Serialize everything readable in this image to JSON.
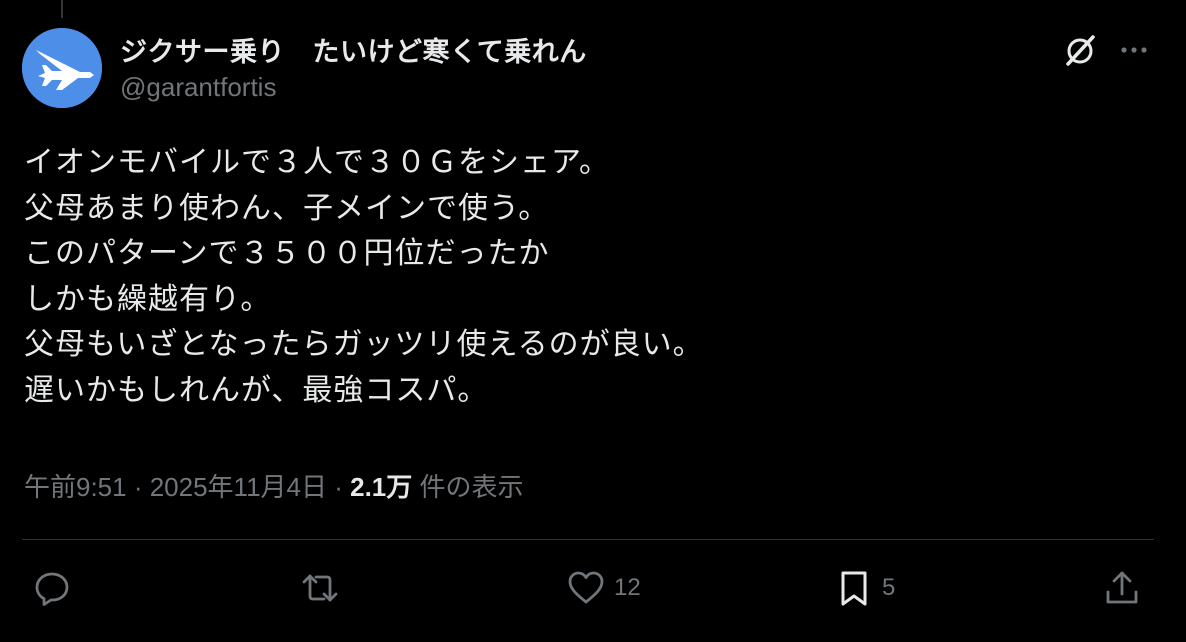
{
  "author": {
    "display_name": "ジクサー乗り　たいけど寒くて乗れん",
    "handle": "@garantfortis",
    "avatar_color": "#4d8fe8"
  },
  "tweet": {
    "lines": [
      "イオンモバイルで３人で３０Ｇをシェア。",
      "父母あまり使わん、子メインで使う。",
      "このパターンで３５００円位だったか",
      "しかも繰越有り。",
      "父母もいざとなったらガッツリ使えるのが良い。",
      "遅いかもしれんが、最強コスパ。"
    ]
  },
  "meta": {
    "time": "午前9:51",
    "separator1": " · ",
    "date": "2025年11月4日",
    "separator2": " · ",
    "views_count": "2.1万",
    "views_label": " 件の表示"
  },
  "actions": {
    "reply_count": "",
    "repost_count": "",
    "like_count": "12",
    "bookmark_count": "5"
  },
  "icons": {
    "grok": "grok-icon",
    "more": "more-icon",
    "reply": "reply-icon",
    "repost": "repost-icon",
    "like": "heart-icon",
    "bookmark": "bookmark-icon",
    "share": "share-icon"
  },
  "colors": {
    "background": "#000000",
    "text_primary": "#e7e9ea",
    "text_secondary": "#71767b",
    "divider": "#2f3336"
  }
}
